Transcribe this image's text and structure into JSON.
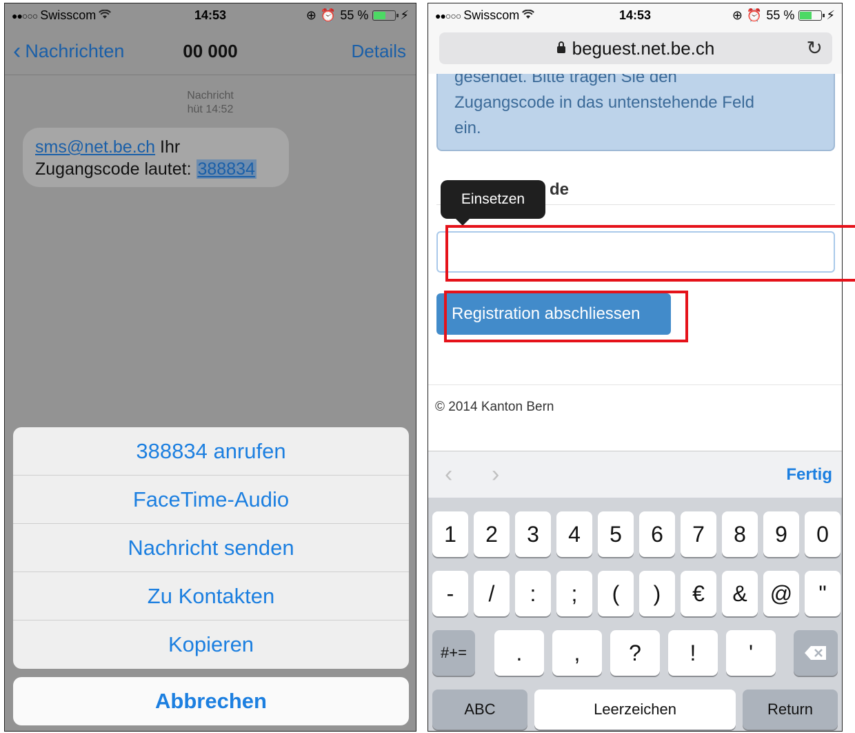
{
  "left": {
    "status": {
      "carrier": "Swisscom",
      "time": "14:53",
      "battery": "55 %",
      "battery_level": 0.55
    },
    "nav": {
      "back": "Nachrichten",
      "title": "00 000",
      "details": "Details"
    },
    "meta": {
      "line1": "Nachricht",
      "line2": "hüt 14:52"
    },
    "message": {
      "sender": "sms@net.be.ch",
      "text1": " Ihr",
      "text2": "Zugangscode lautet: ",
      "code": "388834"
    },
    "actions": [
      "388834 anrufen",
      "FaceTime-Audio",
      "Nachricht senden",
      "Zu Kontakten",
      "Kopieren"
    ],
    "cancel": "Abbrechen"
  },
  "right": {
    "status": {
      "carrier": "Swisscom",
      "time": "14:53",
      "battery": "55 %",
      "battery_level": 0.55
    },
    "url": "beguest.net.be.ch",
    "info": {
      "line1": "gesendet. Bitte tragen Sie den",
      "line2": "Zugangscode in das untenstehende Feld",
      "line3": "ein."
    },
    "field_label": "de",
    "tooltip": "Einsetzen",
    "submit": "Registration abschliessen",
    "footer": "© 2014 Kanton Bern",
    "toolbar_done": "Fertig",
    "keyboard": {
      "row1": [
        "1",
        "2",
        "3",
        "4",
        "5",
        "6",
        "7",
        "8",
        "9",
        "0"
      ],
      "row2": [
        "-",
        "/",
        ":",
        ";",
        "(",
        ")",
        "€",
        "&",
        "@",
        "\""
      ],
      "row3_mode": "#+=",
      "row3": [
        ".",
        ",",
        "?",
        "!",
        "'"
      ],
      "abc": "ABC",
      "space": "Leerzeichen",
      "return": "Return"
    }
  }
}
